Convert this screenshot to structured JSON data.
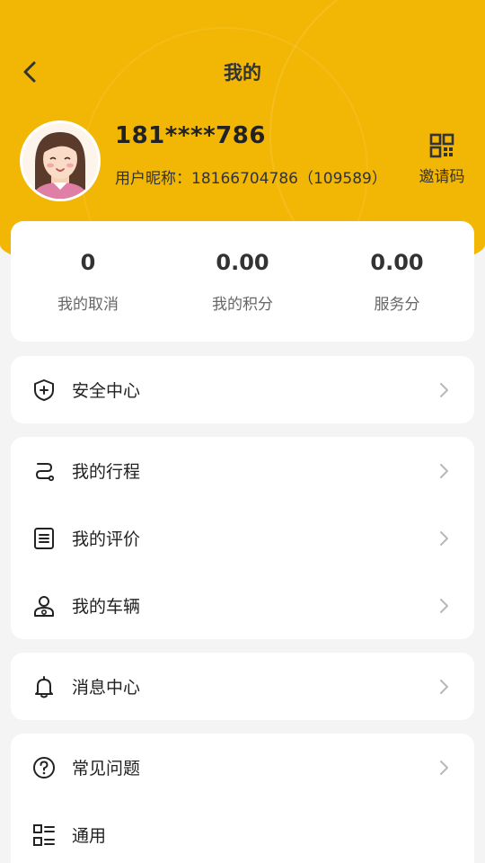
{
  "header": {
    "title": "我的",
    "colors": {
      "accent": "#f2b705",
      "background": "#f4f4f4",
      "card": "#ffffff"
    }
  },
  "profile": {
    "phone": "181****786",
    "nickname_label": "用户昵称：",
    "nickname_value": "18166704786（109589）",
    "invite_label": "邀请码"
  },
  "stats": [
    {
      "value": "0",
      "label": "我的取消"
    },
    {
      "value": "0.00",
      "label": "我的积分"
    },
    {
      "value": "0.00",
      "label": "服务分"
    }
  ],
  "menu_groups": [
    [
      {
        "label": "安全中心",
        "icon": "shield-plus-icon"
      }
    ],
    [
      {
        "label": "我的行程",
        "icon": "route-icon"
      },
      {
        "label": "我的评价",
        "icon": "document-icon"
      },
      {
        "label": "我的车辆",
        "icon": "driver-icon"
      }
    ],
    [
      {
        "label": "消息中心",
        "icon": "bell-icon"
      }
    ],
    [
      {
        "label": "常见问题",
        "icon": "question-icon"
      },
      {
        "label": "通用",
        "icon": "grid-list-icon"
      }
    ]
  ]
}
